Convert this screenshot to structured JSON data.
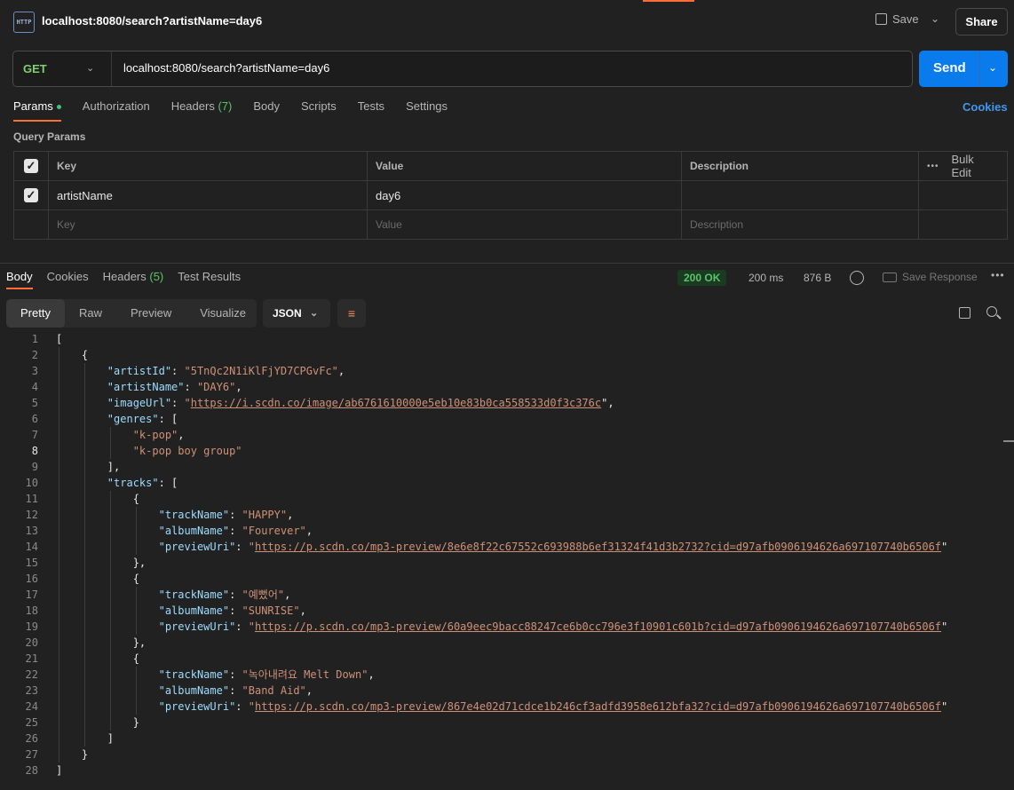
{
  "tab": {
    "title": "localhost:8080/search?artistName=day6",
    "icon": "http-icon"
  },
  "header": {
    "save_label": "Save",
    "share_label": "Share"
  },
  "request": {
    "method": "GET",
    "url": "localhost:8080/search?artistName=day6",
    "send_label": "Send"
  },
  "request_tabs": {
    "params": "Params",
    "authorization": "Authorization",
    "headers": "Headers",
    "headers_count": "(7)",
    "body": "Body",
    "scripts": "Scripts",
    "tests": "Tests",
    "settings": "Settings",
    "cookies": "Cookies"
  },
  "query_params": {
    "title": "Query Params",
    "columns": {
      "key": "Key",
      "value": "Value",
      "description": "Description",
      "bulk_edit": "Bulk Edit"
    },
    "rows": [
      {
        "checked": true,
        "key": "artistName",
        "value": "day6",
        "description": ""
      }
    ],
    "placeholders": {
      "key": "Key",
      "value": "Value",
      "description": "Description"
    }
  },
  "response_tabs": {
    "body": "Body",
    "cookies": "Cookies",
    "headers": "Headers",
    "headers_count": "(5)",
    "test_results": "Test Results"
  },
  "response_status": {
    "status": "200 OK",
    "time": "200 ms",
    "size": "876 B",
    "save_response": "Save Response"
  },
  "view_tabs": {
    "pretty": "Pretty",
    "raw": "Raw",
    "preview": "Preview",
    "visualize": "Visualize"
  },
  "format": "JSON",
  "colors": {
    "accent": "#ff6c37",
    "send": "#097bed",
    "ok": "#5ac46a",
    "json_key": "#9cdcfe",
    "json_string": "#ce9178"
  },
  "code_lines": [
    "[",
    "    {",
    "        \"artistId\": \"5TnQc2N1iKlFjYD7CPGvFc\",",
    "        \"artistName\": \"DAY6\",",
    "        \"imageUrl\": \"https://i.scdn.co/image/ab6761610000e5eb10e83b0ca558533d0f3c376c\",",
    "        \"genres\": [",
    "            \"k-pop\",",
    "            \"k-pop boy group\"",
    "        ],",
    "        \"tracks\": [",
    "            {",
    "                \"trackName\": \"HAPPY\",",
    "                \"albumName\": \"Fourever\",",
    "                \"previewUri\": \"https://p.scdn.co/mp3-preview/8e6e8f22c67552c693988b6ef31324f41d3b2732?cid=d97afb0906194626a697107740b6506f\"",
    "            },",
    "            {",
    "                \"trackName\": \"예뻤어\",",
    "                \"albumName\": \"SUNRISE\",",
    "                \"previewUri\": \"https://p.scdn.co/mp3-preview/60a9eec9bacc88247ce6b0cc796e3f10901c601b?cid=d97afb0906194626a697107740b6506f\"",
    "            },",
    "            {",
    "                \"trackName\": \"녹아내려요 Melt Down\",",
    "                \"albumName\": \"Band Aid\",",
    "                \"previewUri\": \"https://p.scdn.co/mp3-preview/867e4e02d71cdce1b246cf3adfd3958e612bfa32?cid=d97afb0906194626a697107740b6506f\"",
    "            }",
    "        ]",
    "    }",
    "]"
  ]
}
